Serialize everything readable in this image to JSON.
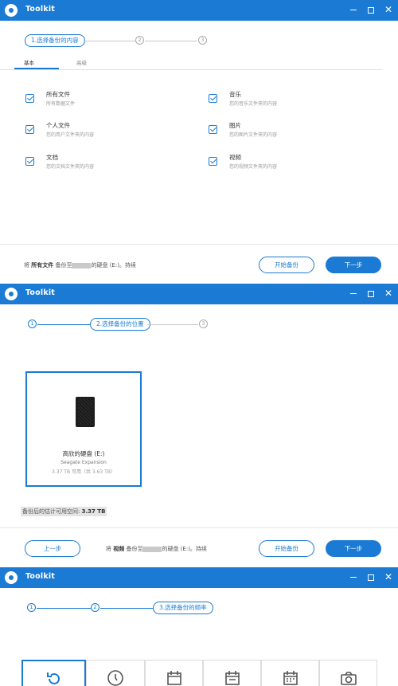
{
  "app": {
    "title": "Toolkit"
  },
  "window_controls": {
    "minimize": "minimize-icon",
    "maximize": "maximize-icon",
    "close": "✕"
  },
  "colors": {
    "accent": "#1a7ad4",
    "titlebar": "#1a7ad4"
  },
  "step1": {
    "steps": [
      "1.选择备份的内容",
      "2",
      "3"
    ],
    "tabs": [
      "基本",
      "高级"
    ],
    "categories": [
      {
        "title": "所有文件",
        "desc": "所有数据文件",
        "checked": true
      },
      {
        "title": "音乐",
        "desc": "您的音乐文件夹的内容",
        "checked": true
      },
      {
        "title": "个人文件",
        "desc": "您的用户文件夹的内容",
        "checked": true
      },
      {
        "title": "图片",
        "desc": "您的图片文件夹的内容",
        "checked": true
      },
      {
        "title": "文档",
        "desc": "您的文档文件夹的内容",
        "checked": true
      },
      {
        "title": "视频",
        "desc": "您的视频文件夹的内容",
        "checked": true
      }
    ],
    "summary": {
      "prefix": "将",
      "what": "所有文件",
      "mid": "备份至",
      "dest": "的硬盘 (E:)。持续"
    },
    "buttons": {
      "start": "开始备份",
      "next": "下一步"
    }
  },
  "step2": {
    "steps": [
      "1",
      "2.选择备份的位置",
      "3"
    ],
    "disk": {
      "name": "高欣的硬盘 (E:)",
      "model": "Seagate Expansion",
      "capacity": "3.37 TB 可用（共 3.63 TB）",
      "icon": "external-drive-icon"
    },
    "estimate": {
      "label": "备份后的估计可用空间:",
      "value": "3.37 TB"
    },
    "summary": {
      "prefix": "将",
      "what": "视频",
      "mid": "备份至",
      "dest": "的硬盘 (E:)。持续"
    },
    "buttons": {
      "prev": "上一步",
      "start": "开始备份",
      "next": "下一步"
    }
  },
  "step3": {
    "steps": [
      "1",
      "2",
      "3.选择备份的频率"
    ],
    "options": [
      {
        "icon": "continuous-icon",
        "selected": true
      },
      {
        "icon": "clock-icon",
        "selected": false
      },
      {
        "icon": "daily-calendar-icon",
        "selected": false
      },
      {
        "icon": "weekly-calendar-icon",
        "selected": false
      },
      {
        "icon": "monthly-calendar-icon",
        "selected": false
      },
      {
        "icon": "camera-icon",
        "selected": false
      }
    ]
  }
}
